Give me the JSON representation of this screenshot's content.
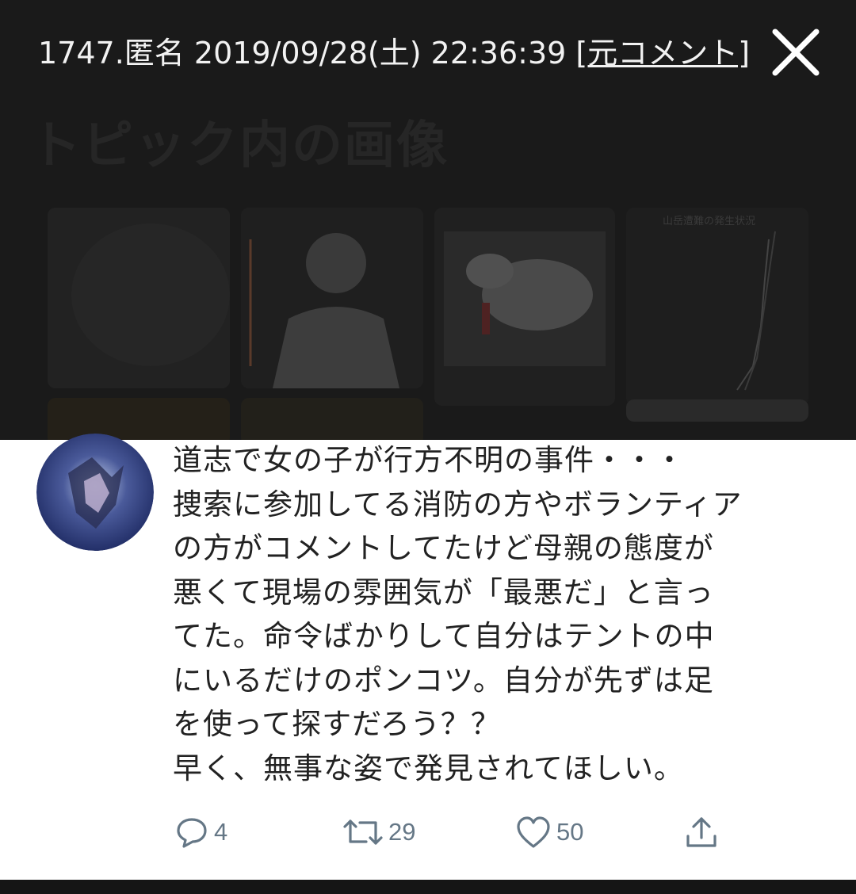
{
  "header": {
    "post_number": "1747.",
    "author": "匿名",
    "timestamp": "2019/09/28(土) 22:36:39",
    "original_comment_link": "[元コメント]"
  },
  "topic_images": {
    "heading": "トピック内の画像",
    "chart_thumb_title": "山岳遭難の発生状況"
  },
  "tweet": {
    "lines": [
      "道志で女の子が行方不明の事件・・・",
      "捜索に参加してる消防の方やボランティア",
      "の方がコメントしてたけど母親の態度が",
      "悪くて現場の雰囲気が「最悪だ」と言っ",
      "てた。命令ばかりして自分はテントの中",
      "にいるだけのポンコツ。自分が先ずは足",
      "を使って探すだろう？？",
      "早く、無事な姿で発見されてほしい。"
    ],
    "actions": {
      "reply_count": "4",
      "retweet_count": "29",
      "like_count": "50"
    }
  },
  "icons": {
    "close": "close-icon",
    "reply": "reply-icon",
    "retweet": "retweet-icon",
    "like": "heart-icon",
    "share": "share-icon"
  },
  "colors": {
    "overlay_bg": "#1a1a1a",
    "header_text": "#f2f2f2",
    "tweet_text": "#222222",
    "action_gray": "#657786"
  }
}
